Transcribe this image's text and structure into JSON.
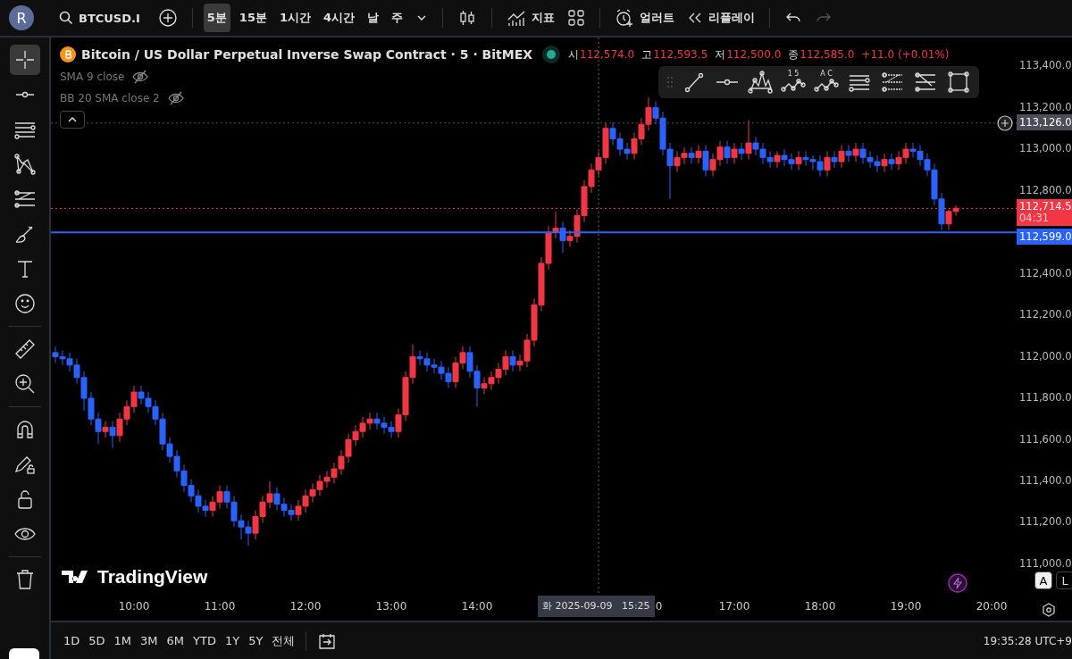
{
  "top_bar": {
    "avatar": "R",
    "symbol": "BTCUSD.I",
    "intervals": [
      {
        "label": "5분",
        "selected": true
      },
      {
        "label": "15분",
        "selected": false
      },
      {
        "label": "1시간",
        "selected": false
      },
      {
        "label": "4시간",
        "selected": false
      },
      {
        "label": "날",
        "selected": false
      },
      {
        "label": "주",
        "selected": false
      }
    ],
    "indicators": "지표",
    "alert": "얼러트",
    "replay": "리플레이"
  },
  "left_toolbar": {
    "tools": [
      {
        "kind": "crosshair",
        "selected": true
      },
      {
        "kind": "hline",
        "selected": false
      },
      {
        "kind": "lines",
        "selected": false
      },
      {
        "kind": "pattern",
        "selected": false
      },
      {
        "kind": "fib",
        "selected": false
      },
      {
        "kind": "brush",
        "selected": false
      },
      {
        "kind": "text",
        "selected": false
      },
      {
        "kind": "emoji",
        "selected": false
      },
      {
        "kind": "divider"
      },
      {
        "kind": "ruler",
        "selected": false
      },
      {
        "kind": "zoom",
        "selected": false
      },
      {
        "kind": "divider"
      },
      {
        "kind": "magnet",
        "selected": false
      },
      {
        "kind": "pencil-lock",
        "selected": false
      },
      {
        "kind": "lock",
        "selected": false
      },
      {
        "kind": "eye",
        "selected": false
      },
      {
        "kind": "divider"
      },
      {
        "kind": "trash",
        "selected": false
      }
    ]
  },
  "legend": {
    "title": "Bitcoin / US Dollar Perpetual Inverse Swap Contract · 5 · BitMEX",
    "ohlc": [
      {
        "label": "시",
        "value": "112,574.0"
      },
      {
        "label": "고",
        "value": "112,593.5"
      },
      {
        "label": "저",
        "value": "112,500.0"
      },
      {
        "label": "종",
        "value": "112,585.0"
      }
    ],
    "change": "+11.0 (+0.01%)",
    "indicators": [
      {
        "name": "SMA 9 close"
      },
      {
        "name": "BB 20 SMA close 2"
      }
    ]
  },
  "drawing_toolbar": {
    "tools": [
      {
        "kind": "trend"
      },
      {
        "kind": "hray"
      },
      {
        "kind": "pattern"
      },
      {
        "kind": "wave",
        "label": "1 5"
      },
      {
        "kind": "wave",
        "label": "A C"
      },
      {
        "kind": "lines"
      },
      {
        "kind": "fib"
      },
      {
        "kind": "fib2"
      },
      {
        "kind": "rect"
      }
    ]
  },
  "chart_data": {
    "type": "candlestick",
    "ylim": [
      110858,
      113538
    ],
    "xlim": [
      541.875,
      1217.5
    ],
    "ref_lines": [
      {
        "axis": "y",
        "value": 113126,
        "label": "113,126.0",
        "color": "#4a4e59"
      },
      {
        "axis": "y",
        "value": 112714.5,
        "label": "112,714.5",
        "color": "#f23645"
      },
      {
        "axis": "y",
        "value": 112599,
        "label": "112,599.0",
        "color": "#2962ff"
      },
      {
        "axis": "x",
        "value": 925,
        "color": "#666666"
      }
    ],
    "yticks": [
      {
        "value": 113400,
        "label": "113,400.0"
      },
      {
        "value": 113200,
        "label": "113,200.0"
      },
      {
        "value": 113000,
        "label": "113,000.0"
      },
      {
        "value": 112800,
        "label": "112,800.0"
      },
      {
        "value": 112400,
        "label": "112,400.0"
      },
      {
        "value": 112200,
        "label": "112,200.0"
      },
      {
        "value": 112000,
        "label": "112,000.0"
      },
      {
        "value": 111800,
        "label": "111,800.0"
      },
      {
        "value": 111600,
        "label": "111,600.0"
      },
      {
        "value": 111400,
        "label": "111,400.0"
      },
      {
        "value": 111200,
        "label": "111,200.0"
      },
      {
        "value": 111000,
        "label": "111,000.0"
      }
    ],
    "xticks": [
      {
        "value": 600,
        "label": "10:00"
      },
      {
        "value": 660,
        "label": "11:00"
      },
      {
        "value": 720,
        "label": "12:00"
      },
      {
        "value": 780,
        "label": "13:00"
      },
      {
        "value": 840,
        "label": "14:00"
      },
      {
        "value": 1020,
        "label": "17:00"
      },
      {
        "value": 1080,
        "label": "18:00"
      },
      {
        "value": 1140,
        "label": "19:00"
      },
      {
        "value": 1200,
        "label": "20:00"
      }
    ],
    "x": [
      545,
      550,
      555,
      560,
      565,
      570,
      575,
      580,
      585,
      590,
      595,
      600,
      605,
      610,
      615,
      620,
      625,
      630,
      635,
      640,
      645,
      650,
      655,
      660,
      665,
      670,
      675,
      680,
      685,
      690,
      695,
      700,
      705,
      710,
      715,
      720,
      725,
      730,
      735,
      740,
      745,
      750,
      755,
      760,
      765,
      770,
      775,
      780,
      785,
      790,
      795,
      800,
      805,
      810,
      815,
      820,
      825,
      830,
      835,
      840,
      845,
      850,
      855,
      860,
      865,
      870,
      875,
      880,
      885,
      890,
      895,
      900,
      905,
      910,
      915,
      920,
      925,
      930,
      935,
      940,
      945,
      950,
      955,
      960,
      965,
      970,
      975,
      980,
      985,
      990,
      995,
      1000,
      1005,
      1010,
      1015,
      1020,
      1025,
      1030,
      1035,
      1040,
      1045,
      1050,
      1055,
      1060,
      1065,
      1070,
      1075,
      1080,
      1085,
      1090,
      1095,
      1100,
      1105,
      1110,
      1115,
      1120,
      1125,
      1130,
      1135,
      1140,
      1145,
      1150,
      1155,
      1160,
      1165,
      1170,
      1175
    ],
    "ohlc": [
      [
        112020,
        112050,
        111970,
        112000
      ],
      [
        112000,
        112030,
        111960,
        111990
      ],
      [
        111990,
        112020,
        111930,
        111960
      ],
      [
        111960,
        111990,
        111870,
        111900
      ],
      [
        111900,
        111930,
        111740,
        111800
      ],
      [
        111800,
        111830,
        111670,
        111700
      ],
      [
        111700,
        111730,
        111580,
        111640
      ],
      [
        111640,
        111690,
        111610,
        111660
      ],
      [
        111660,
        111690,
        111560,
        111620
      ],
      [
        111620,
        111730,
        111590,
        111700
      ],
      [
        111700,
        111790,
        111670,
        111760
      ],
      [
        111760,
        111860,
        111730,
        111830
      ],
      [
        111830,
        111860,
        111770,
        111800
      ],
      [
        111800,
        111830,
        111730,
        111760
      ],
      [
        111760,
        111790,
        111670,
        111700
      ],
      [
        111700,
        111730,
        111550,
        111580
      ],
      [
        111580,
        111610,
        111490,
        111520
      ],
      [
        111520,
        111550,
        111420,
        111450
      ],
      [
        111450,
        111480,
        111350,
        111380
      ],
      [
        111380,
        111410,
        111300,
        111330
      ],
      [
        111330,
        111360,
        111250,
        111280
      ],
      [
        111280,
        111310,
        111230,
        111260
      ],
      [
        111260,
        111330,
        111230,
        111300
      ],
      [
        111300,
        111380,
        111270,
        111350
      ],
      [
        111350,
        111380,
        111270,
        111300
      ],
      [
        111300,
        111330,
        111180,
        111210
      ],
      [
        111210,
        111240,
        111120,
        111180
      ],
      [
        111180,
        111210,
        111090,
        111150
      ],
      [
        111150,
        111260,
        111120,
        111230
      ],
      [
        111230,
        111330,
        111200,
        111300
      ],
      [
        111300,
        111400,
        111270,
        111340
      ],
      [
        111340,
        111370,
        111260,
        111290
      ],
      [
        111290,
        111320,
        111230,
        111260
      ],
      [
        111260,
        111290,
        111210,
        111240
      ],
      [
        111240,
        111310,
        111210,
        111280
      ],
      [
        111280,
        111360,
        111250,
        111330
      ],
      [
        111330,
        111390,
        111300,
        111360
      ],
      [
        111360,
        111430,
        111330,
        111400
      ],
      [
        111400,
        111450,
        111370,
        111420
      ],
      [
        111420,
        111490,
        111390,
        111460
      ],
      [
        111460,
        111550,
        111430,
        111520
      ],
      [
        111520,
        111630,
        111490,
        111600
      ],
      [
        111600,
        111670,
        111570,
        111640
      ],
      [
        111640,
        111710,
        111610,
        111680
      ],
      [
        111680,
        111730,
        111650,
        111700
      ],
      [
        111700,
        111730,
        111650,
        111680
      ],
      [
        111680,
        111710,
        111630,
        111660
      ],
      [
        111660,
        111690,
        111610,
        111640
      ],
      [
        111640,
        111750,
        111610,
        111720
      ],
      [
        111720,
        111930,
        111690,
        111900
      ],
      [
        111900,
        112060,
        111870,
        112000
      ],
      [
        112000,
        112030,
        111960,
        111990
      ],
      [
        111990,
        112020,
        111930,
        111960
      ],
      [
        111960,
        111990,
        111920,
        111950
      ],
      [
        111950,
        111980,
        111890,
        111920
      ],
      [
        111920,
        111950,
        111850,
        111880
      ],
      [
        111880,
        112000,
        111850,
        111970
      ],
      [
        111970,
        112050,
        111940,
        112020
      ],
      [
        112020,
        112050,
        111900,
        111930
      ],
      [
        111930,
        111960,
        111760,
        111850
      ],
      [
        111850,
        111900,
        111820,
        111870
      ],
      [
        111870,
        111930,
        111840,
        111900
      ],
      [
        111900,
        111970,
        111870,
        111940
      ],
      [
        111940,
        112030,
        111910,
        112000
      ],
      [
        112000,
        112030,
        111930,
        111960
      ],
      [
        111960,
        112010,
        111930,
        111980
      ],
      [
        111980,
        112110,
        111950,
        112080
      ],
      [
        112080,
        112280,
        112050,
        112250
      ],
      [
        112250,
        112480,
        112220,
        112450
      ],
      [
        112450,
        112630,
        112420,
        112600
      ],
      [
        112600,
        112700,
        112570,
        112620
      ],
      [
        112620,
        112650,
        112500,
        112560
      ],
      [
        112560,
        112610,
        112530,
        112580
      ],
      [
        112580,
        112710,
        112550,
        112680
      ],
      [
        112680,
        112850,
        112650,
        112820
      ],
      [
        112820,
        112930,
        112790,
        112900
      ],
      [
        112900,
        112990,
        112870,
        112960
      ],
      [
        112960,
        113130,
        112930,
        113100
      ],
      [
        113100,
        113130,
        113020,
        113050
      ],
      [
        113050,
        113080,
        112970,
        113000
      ],
      [
        113000,
        113030,
        112950,
        112980
      ],
      [
        112980,
        113080,
        112950,
        113050
      ],
      [
        113050,
        113150,
        113020,
        113120
      ],
      [
        113120,
        113250,
        113090,
        113200
      ],
      [
        113200,
        113230,
        113120,
        113150
      ],
      [
        113150,
        113180,
        112970,
        113000
      ],
      [
        113000,
        113030,
        112760,
        112920
      ],
      [
        112920,
        112990,
        112890,
        112960
      ],
      [
        112960,
        113010,
        112930,
        112980
      ],
      [
        112980,
        113010,
        112930,
        112960
      ],
      [
        112960,
        113020,
        112930,
        112990
      ],
      [
        112990,
        113020,
        112870,
        112900
      ],
      [
        112900,
        112980,
        112870,
        112950
      ],
      [
        112950,
        113040,
        112920,
        113010
      ],
      [
        113010,
        113040,
        112930,
        112960
      ],
      [
        112960,
        113030,
        112930,
        113000
      ],
      [
        113000,
        113030,
        112950,
        112980
      ],
      [
        112980,
        113140,
        112950,
        113030
      ],
      [
        113030,
        113060,
        112970,
        113000
      ],
      [
        113000,
        113030,
        112930,
        112960
      ],
      [
        112960,
        112990,
        112910,
        112940
      ],
      [
        112940,
        112990,
        112910,
        112970
      ],
      [
        112970,
        113000,
        112920,
        112950
      ],
      [
        112950,
        112980,
        112900,
        112930
      ],
      [
        112930,
        112990,
        112900,
        112960
      ],
      [
        112960,
        112990,
        112920,
        112950
      ],
      [
        112950,
        112970,
        112900,
        112940
      ],
      [
        112940,
        112970,
        112870,
        112900
      ],
      [
        112900,
        112990,
        112870,
        112960
      ],
      [
        112960,
        112990,
        112910,
        112940
      ],
      [
        112940,
        113020,
        112910,
        112990
      ],
      [
        112990,
        113020,
        112940,
        112970
      ],
      [
        112970,
        113030,
        112940,
        113000
      ],
      [
        113000,
        113030,
        112930,
        112960
      ],
      [
        112960,
        112990,
        112910,
        112940
      ],
      [
        112940,
        112970,
        112890,
        112920
      ],
      [
        112920,
        112980,
        112890,
        112950
      ],
      [
        112950,
        112980,
        112900,
        112930
      ],
      [
        112930,
        112990,
        112900,
        112960
      ],
      [
        112960,
        113030,
        112930,
        113000
      ],
      [
        113000,
        113030,
        112960,
        112990
      ],
      [
        112990,
        113020,
        112920,
        112950
      ],
      [
        112950,
        112980,
        112870,
        112900
      ],
      [
        112900,
        112930,
        112730,
        112760
      ],
      [
        112760,
        112790,
        112610,
        112640
      ],
      [
        112640,
        112710,
        112610,
        112700
      ],
      [
        112700,
        112730,
        112680,
        112715
      ]
    ]
  },
  "price_axis": {
    "countdown": "04:31"
  },
  "time_axis": {
    "crosshair_label": "화 2025-09-09   15:25",
    "partial_label": "0"
  },
  "logo": "TradingView",
  "scale_buttons": [
    {
      "label": "A",
      "selected": true
    },
    {
      "label": "L",
      "selected": false
    }
  ],
  "bottom_bar": {
    "ranges": [
      "1D",
      "5D",
      "1M",
      "3M",
      "6M",
      "YTD",
      "1Y",
      "5Y",
      "전체"
    ],
    "clock": "19:35:28 UTC+9"
  }
}
